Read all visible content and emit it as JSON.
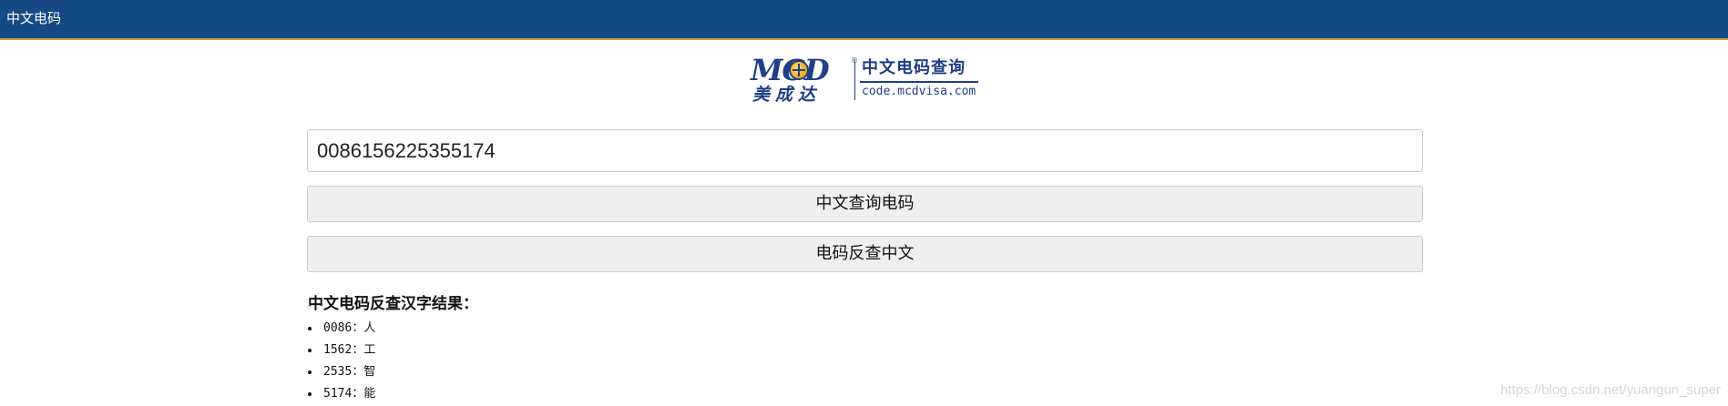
{
  "topbar": {
    "title": "中文电码"
  },
  "logo": {
    "brand_latin": "MCD",
    "brand_cn": "美成达",
    "title_cn": "中文电码查询",
    "domain": "code.mcdvisa.com",
    "colors": {
      "primary": "#1f3f86",
      "accent": "#f0a51d"
    }
  },
  "form": {
    "code_input_value": "0086156225355174",
    "cn_to_code_label": "中文查询电码",
    "code_to_cn_label": "电码反查中文"
  },
  "result": {
    "title": "中文电码反查汉字结果：",
    "items": [
      {
        "code": "0086",
        "sep": "：",
        "char": "人"
      },
      {
        "code": "1562",
        "sep": "：",
        "char": "工"
      },
      {
        "code": "2535",
        "sep": "：",
        "char": "智"
      },
      {
        "code": "5174",
        "sep": "：",
        "char": "能"
      }
    ]
  },
  "watermark": "https://blog.csdn.net/yuangun_super",
  "colors": {
    "topbar": "#154a85",
    "topbar_border": "#c8a13a"
  }
}
